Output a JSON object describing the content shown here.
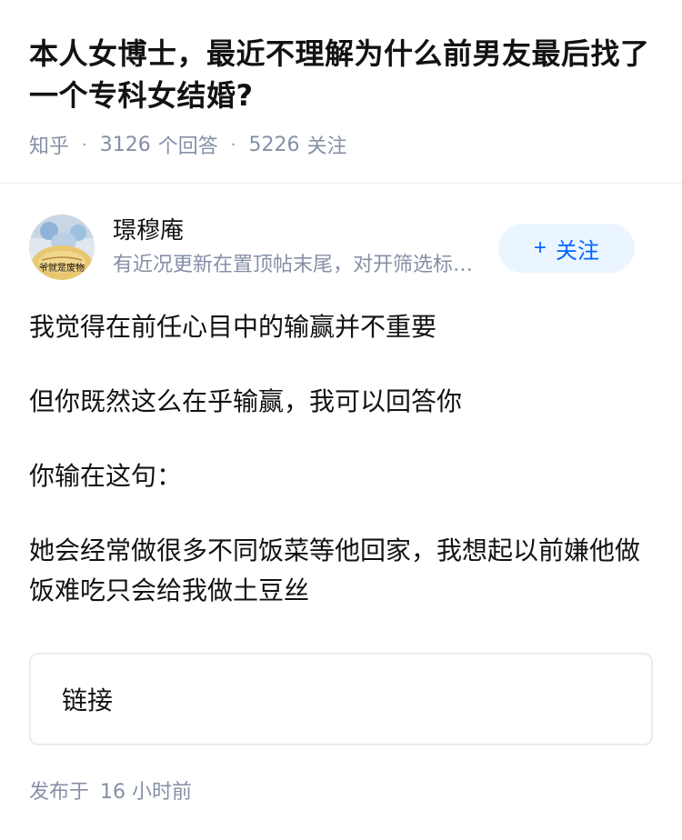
{
  "question": {
    "title": "本人女博士，最近不理解为什么前男友最后找了一个专科女结婚?",
    "source": "知乎",
    "answers_count": "3126",
    "answers_label": "个回答",
    "followers_count": "5226",
    "followers_label": "关注",
    "separator": "·"
  },
  "author": {
    "name": "璟穆庵",
    "bio": "有近况更新在置顶帖末尾，对开筛选标准和情感问题感兴趣的朋友可以私信",
    "avatar_text": "爷就是废物",
    "follow_plus": "+",
    "follow_label": "关注"
  },
  "answer": {
    "paragraphs": [
      "我觉得在前任心目中的输赢并不重要",
      "但你既然这么在乎输赢，我可以回答你",
      "你输在这句：",
      "她会经常做很多不同饭菜等他回家，我想起以前嫌他做饭难吃只会给我做土豆丝"
    ],
    "link_label": "链接"
  },
  "footer": {
    "published_label": "发布于",
    "published_time": "16 小时前"
  },
  "colors": {
    "text": "#121212",
    "meta": "#8590a6",
    "accent": "#0066ff",
    "follow_bg": "#ebf5ff",
    "divider": "#ebebeb"
  }
}
